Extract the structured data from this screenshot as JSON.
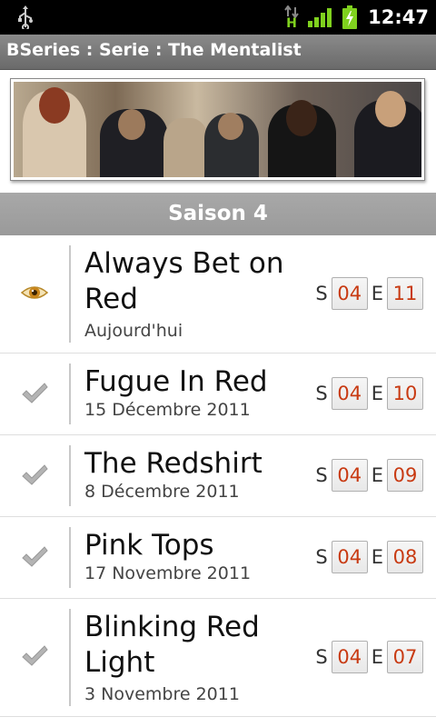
{
  "status_bar": {
    "time": "12:47",
    "network_type": "H",
    "icons": [
      "usb-icon",
      "data-arrows-icon",
      "signal-icon",
      "battery-charging-icon"
    ],
    "colors": {
      "signal": "#7fd11e",
      "battery": "#7fd11e"
    }
  },
  "app": {
    "title": "BSeries : Serie : The Mentalist"
  },
  "banner": {
    "icon": "show-banner-image"
  },
  "season": {
    "label": "Saison 4"
  },
  "episodes": [
    {
      "title": "Always Bet on Red",
      "date": "Aujourd'hui",
      "status": "eye-icon",
      "season_label": "S",
      "season": "04",
      "episode_label": "E",
      "episode": "11"
    },
    {
      "title": "Fugue In Red",
      "date": "15 Décembre 2011",
      "status": "checkmark-icon",
      "season_label": "S",
      "season": "04",
      "episode_label": "E",
      "episode": "10"
    },
    {
      "title": "The Redshirt",
      "date": "8 Décembre 2011",
      "status": "checkmark-icon",
      "season_label": "S",
      "season": "04",
      "episode_label": "E",
      "episode": "09"
    },
    {
      "title": "Pink Tops",
      "date": "17 Novembre 2011",
      "status": "checkmark-icon",
      "season_label": "S",
      "season": "04",
      "episode_label": "E",
      "episode": "08"
    },
    {
      "title": "Blinking Red Light",
      "date": "3 Novembre 2011",
      "status": "checkmark-icon",
      "season_label": "S",
      "season": "04",
      "episode_label": "E",
      "episode": "07"
    }
  ],
  "colors": {
    "accent_number": "#c83a12",
    "title_bar": "#7a7a7a",
    "season_bar": "#a0a0a0"
  }
}
